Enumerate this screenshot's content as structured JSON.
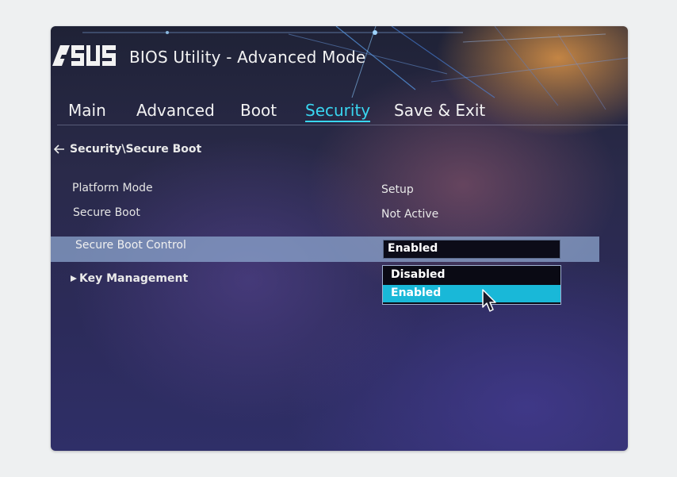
{
  "header": {
    "brand": "ASUS",
    "title": "BIOS Utility - Advanced Mode"
  },
  "tabs": [
    {
      "label": "Main",
      "active": false
    },
    {
      "label": "Advanced",
      "active": false
    },
    {
      "label": "Boot",
      "active": false
    },
    {
      "label": "Security",
      "active": true
    },
    {
      "label": "Save & Exit",
      "active": false
    }
  ],
  "breadcrumb": {
    "back_icon": "back-arrow-icon",
    "path": "Security\\Secure Boot"
  },
  "settings": [
    {
      "label": "Platform Mode",
      "value": "Setup"
    },
    {
      "label": "Secure Boot",
      "value": "Not Active"
    }
  ],
  "secure_boot_control": {
    "label": "Secure Boot Control",
    "value": "Enabled",
    "options": [
      "Disabled",
      "Enabled"
    ],
    "highlighted_option": "Enabled"
  },
  "submenu": {
    "label": "Key Management",
    "icon": "triangle-right-icon"
  },
  "colors": {
    "accent": "#39d6f0",
    "selected_option": "#19b8d8",
    "row_highlight": "#8ca5cd"
  }
}
